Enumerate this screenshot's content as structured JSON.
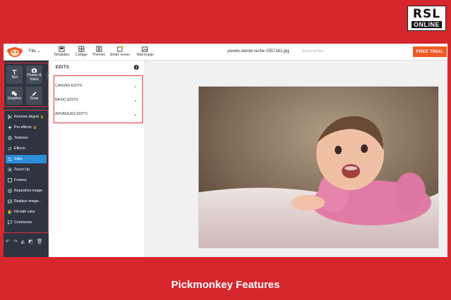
{
  "logo": {
    "top": "RSL",
    "bottom": "ONLINE"
  },
  "topbar": {
    "file_label": "File",
    "tools": [
      {
        "label": "Templates",
        "icon": "templates-icon"
      },
      {
        "label": "Collage",
        "icon": "collage-icon"
      },
      {
        "label": "Themes",
        "icon": "themes-icon"
      },
      {
        "label": "Smart resize",
        "icon": "smart-resize-icon"
      },
      {
        "label": "Add image",
        "icon": "add-image-icon"
      }
    ],
    "doc_title": "pexels-daniel-reche-1557182.jpg",
    "doc_status": "Saved to Hub",
    "trial_label": "FREE TRIAL"
  },
  "sidebar": {
    "tiles": [
      {
        "label": "Text",
        "icon": "text-icon"
      },
      {
        "label": "Photos & Video",
        "icon": "camera-icon"
      },
      {
        "label": "Graphics",
        "icon": "graphics-icon"
      },
      {
        "label": "Draw",
        "icon": "pencil-icon"
      }
    ],
    "items": [
      {
        "label": "Remove bkgnd",
        "icon": "scissors-icon",
        "premium": true
      },
      {
        "label": "Pro effects",
        "icon": "pro-effects-icon",
        "premium": true
      },
      {
        "label": "Textures",
        "icon": "textures-icon"
      },
      {
        "label": "Effects",
        "icon": "effects-icon"
      },
      {
        "label": "Edits",
        "icon": "edits-icon",
        "active": true
      },
      {
        "label": "Touch Up",
        "icon": "touch-up-icon"
      },
      {
        "label": "Frames",
        "icon": "frames-icon"
      },
      {
        "label": "Reposition image",
        "icon": "reposition-icon"
      },
      {
        "label": "Replace image...",
        "icon": "replace-image-icon"
      },
      {
        "label": "Fill with color",
        "icon": "fill-color-icon"
      },
      {
        "label": "Comments",
        "icon": "comments-icon"
      }
    ],
    "bottom_tools": [
      "undo-icon",
      "redo-icon",
      "flip-icon",
      "layers-icon",
      "trash-icon"
    ]
  },
  "panel": {
    "title": "EDITS",
    "sections": [
      {
        "label": "CANVAS EDITS"
      },
      {
        "label": "BASIC EDITS"
      },
      {
        "label": "ADVANCED EDITS"
      }
    ]
  },
  "caption": "Pickmonkey Features",
  "colors": {
    "background": "#d6262e",
    "highlight": "#e0323a",
    "sidebar": "#2e3440",
    "active": "#2a8dd6",
    "trial": "#f05a24"
  }
}
